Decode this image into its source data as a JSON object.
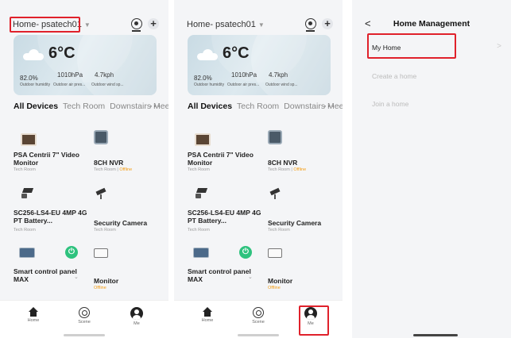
{
  "home_screen": {
    "home_name": "Home- psatech01",
    "weather": {
      "temperature": "6°C",
      "humidity_value": "82.0%",
      "humidity_label": "Outdoor humidity",
      "pressure_value": "1010hPa",
      "pressure_label": "Outdoor air pres...",
      "wind_value": "4.7kph",
      "wind_label": "Outdoor wind sp..."
    },
    "tabs": [
      "All Devices",
      "Tech Room",
      "Downstairs Mee"
    ],
    "more_label": "···",
    "devices": [
      {
        "name": "PSA Centrii 7\" Video Monitor",
        "room": "Tech Room",
        "status": ""
      },
      {
        "name": "8CH NVR",
        "room": "Tech Room",
        "status": "Offline"
      },
      {
        "name": "SC256-LS4-EU 4MP 4G PT Battery...",
        "room": "Tech Room",
        "status": ""
      },
      {
        "name": "Security Camera",
        "room": "Tech Room",
        "status": ""
      },
      {
        "name": "Smart control panel MAX",
        "room": "",
        "status": ""
      },
      {
        "name": "Monitor",
        "room": "",
        "status": "Offline"
      }
    ],
    "separator": "|",
    "power_glyph": "⏻",
    "chevron_glyph": "⌄",
    "nav": {
      "home": "Home",
      "scene": "Scene",
      "me": "Me"
    }
  },
  "home_management": {
    "back_glyph": "<",
    "title": "Home Management",
    "my_home": "My Home",
    "create_home": "Create a home",
    "join_home": "Join a home",
    "row_chevron": ">"
  },
  "colors": {
    "highlight": "#e0212b",
    "offline": "#f39c12",
    "power_green": "#2ec27e"
  }
}
